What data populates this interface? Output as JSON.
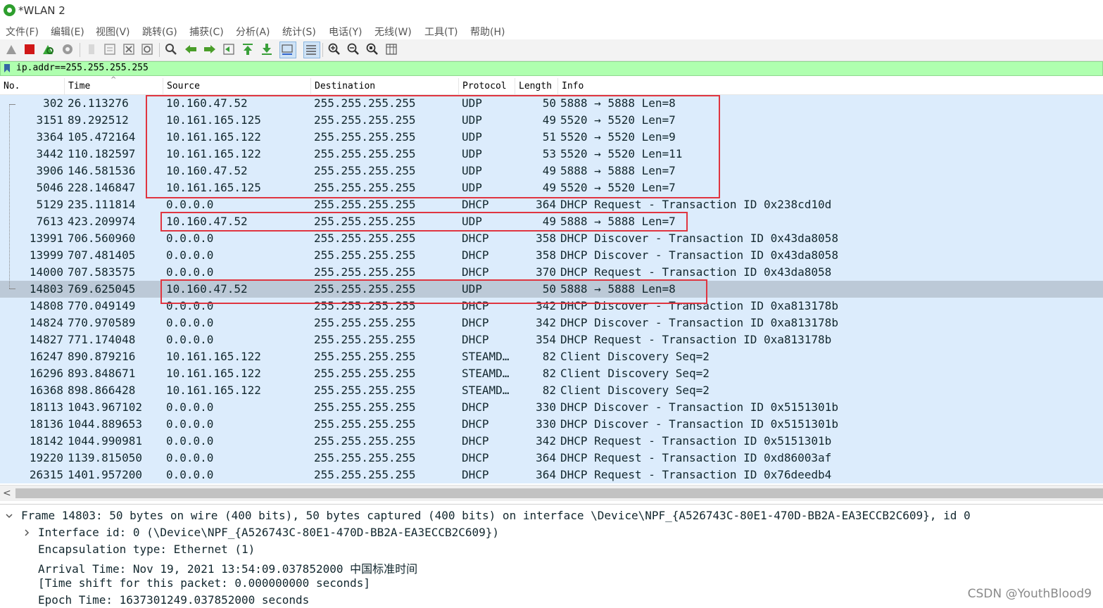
{
  "window": {
    "title": "*WLAN 2"
  },
  "menu": [
    "文件(F)",
    "编辑(E)",
    "视图(V)",
    "跳转(G)",
    "捕获(C)",
    "分析(A)",
    "统计(S)",
    "电话(Y)",
    "无线(W)",
    "工具(T)",
    "帮助(H)"
  ],
  "filter": {
    "value": "ip.addr==255.255.255.255"
  },
  "columns": [
    "No.",
    "Time",
    "Source",
    "Destination",
    "Protocol",
    "Length",
    "Info"
  ],
  "packets": [
    {
      "no": "302",
      "time": "26.113276",
      "src": "10.160.47.52",
      "dst": "255.255.255.255",
      "proto": "UDP",
      "len": "50",
      "info": "5888 → 5888 Len=8"
    },
    {
      "no": "3151",
      "time": "89.292512",
      "src": "10.161.165.125",
      "dst": "255.255.255.255",
      "proto": "UDP",
      "len": "49",
      "info": "5520 → 5520 Len=7"
    },
    {
      "no": "3364",
      "time": "105.472164",
      "src": "10.161.165.122",
      "dst": "255.255.255.255",
      "proto": "UDP",
      "len": "51",
      "info": "5520 → 5520 Len=9"
    },
    {
      "no": "3442",
      "time": "110.182597",
      "src": "10.161.165.122",
      "dst": "255.255.255.255",
      "proto": "UDP",
      "len": "53",
      "info": "5520 → 5520 Len=11"
    },
    {
      "no": "3906",
      "time": "146.581536",
      "src": "10.160.47.52",
      "dst": "255.255.255.255",
      "proto": "UDP",
      "len": "49",
      "info": "5888 → 5888 Len=7"
    },
    {
      "no": "5046",
      "time": "228.146847",
      "src": "10.161.165.125",
      "dst": "255.255.255.255",
      "proto": "UDP",
      "len": "49",
      "info": "5520 → 5520 Len=7"
    },
    {
      "no": "5129",
      "time": "235.111814",
      "src": "0.0.0.0",
      "dst": "255.255.255.255",
      "proto": "DHCP",
      "len": "364",
      "info": "DHCP Request  - Transaction ID 0x238cd10d"
    },
    {
      "no": "7613",
      "time": "423.209974",
      "src": "10.160.47.52",
      "dst": "255.255.255.255",
      "proto": "UDP",
      "len": "49",
      "info": "5888 → 5888 Len=7"
    },
    {
      "no": "13991",
      "time": "706.560960",
      "src": "0.0.0.0",
      "dst": "255.255.255.255",
      "proto": "DHCP",
      "len": "358",
      "info": "DHCP Discover - Transaction ID 0x43da8058"
    },
    {
      "no": "13999",
      "time": "707.481405",
      "src": "0.0.0.0",
      "dst": "255.255.255.255",
      "proto": "DHCP",
      "len": "358",
      "info": "DHCP Discover - Transaction ID 0x43da8058"
    },
    {
      "no": "14000",
      "time": "707.583575",
      "src": "0.0.0.0",
      "dst": "255.255.255.255",
      "proto": "DHCP",
      "len": "370",
      "info": "DHCP Request  - Transaction ID 0x43da8058"
    },
    {
      "no": "14803",
      "time": "769.625045",
      "src": "10.160.47.52",
      "dst": "255.255.255.255",
      "proto": "UDP",
      "len": "50",
      "info": "5888 → 5888 Len=8",
      "selected": true
    },
    {
      "no": "14808",
      "time": "770.049149",
      "src": "0.0.0.0",
      "dst": "255.255.255.255",
      "proto": "DHCP",
      "len": "342",
      "info": "DHCP Discover - Transaction ID 0xa813178b"
    },
    {
      "no": "14824",
      "time": "770.970589",
      "src": "0.0.0.0",
      "dst": "255.255.255.255",
      "proto": "DHCP",
      "len": "342",
      "info": "DHCP Discover - Transaction ID 0xa813178b"
    },
    {
      "no": "14827",
      "time": "771.174048",
      "src": "0.0.0.0",
      "dst": "255.255.255.255",
      "proto": "DHCP",
      "len": "354",
      "info": "DHCP Request  - Transaction ID 0xa813178b"
    },
    {
      "no": "16247",
      "time": "890.879216",
      "src": "10.161.165.122",
      "dst": "255.255.255.255",
      "proto": "STEAMD…",
      "len": "82",
      "info": "Client Discovery Seq=2"
    },
    {
      "no": "16296",
      "time": "893.848671",
      "src": "10.161.165.122",
      "dst": "255.255.255.255",
      "proto": "STEAMD…",
      "len": "82",
      "info": "Client Discovery Seq=2"
    },
    {
      "no": "16368",
      "time": "898.866428",
      "src": "10.161.165.122",
      "dst": "255.255.255.255",
      "proto": "STEAMD…",
      "len": "82",
      "info": "Client Discovery Seq=2"
    },
    {
      "no": "18113",
      "time": "1043.967102",
      "src": "0.0.0.0",
      "dst": "255.255.255.255",
      "proto": "DHCP",
      "len": "330",
      "info": "DHCP Discover - Transaction ID 0x5151301b"
    },
    {
      "no": "18136",
      "time": "1044.889653",
      "src": "0.0.0.0",
      "dst": "255.255.255.255",
      "proto": "DHCP",
      "len": "330",
      "info": "DHCP Discover - Transaction ID 0x5151301b"
    },
    {
      "no": "18142",
      "time": "1044.990981",
      "src": "0.0.0.0",
      "dst": "255.255.255.255",
      "proto": "DHCP",
      "len": "342",
      "info": "DHCP Request  - Transaction ID 0x5151301b"
    },
    {
      "no": "19220",
      "time": "1139.815050",
      "src": "0.0.0.0",
      "dst": "255.255.255.255",
      "proto": "DHCP",
      "len": "364",
      "info": "DHCP Request  - Transaction ID 0xd86003af"
    },
    {
      "no": "26315",
      "time": "1401.957200",
      "src": "0.0.0.0",
      "dst": "255.255.255.255",
      "proto": "DHCP",
      "len": "364",
      "info": "DHCP Request  - Transaction ID 0x76deedb4"
    }
  ],
  "details": {
    "frame": "Frame 14803: 50 bytes on wire (400 bits), 50 bytes captured (400 bits) on interface \\Device\\NPF_{A526743C-80E1-470D-BB2A-EA3ECCB2C609}, id 0",
    "interface": "Interface id: 0 (\\Device\\NPF_{A526743C-80E1-470D-BB2A-EA3ECCB2C609})",
    "encapsulation": "Encapsulation type: Ethernet (1)",
    "arrival": "Arrival Time: Nov 19, 2021 13:54:09.037852000 中国标准时间",
    "timeshift": "[Time shift for this packet: 0.000000000 seconds]",
    "epoch": "Epoch Time: 1637301249.037852000 seconds"
  },
  "watermark": "CSDN @YouthBlood9",
  "colors": {
    "row_bg": "#dcecfc",
    "row_selected": "#bcc9d7",
    "filter_bg": "#afffaf",
    "highlight_box": "#e03540"
  }
}
